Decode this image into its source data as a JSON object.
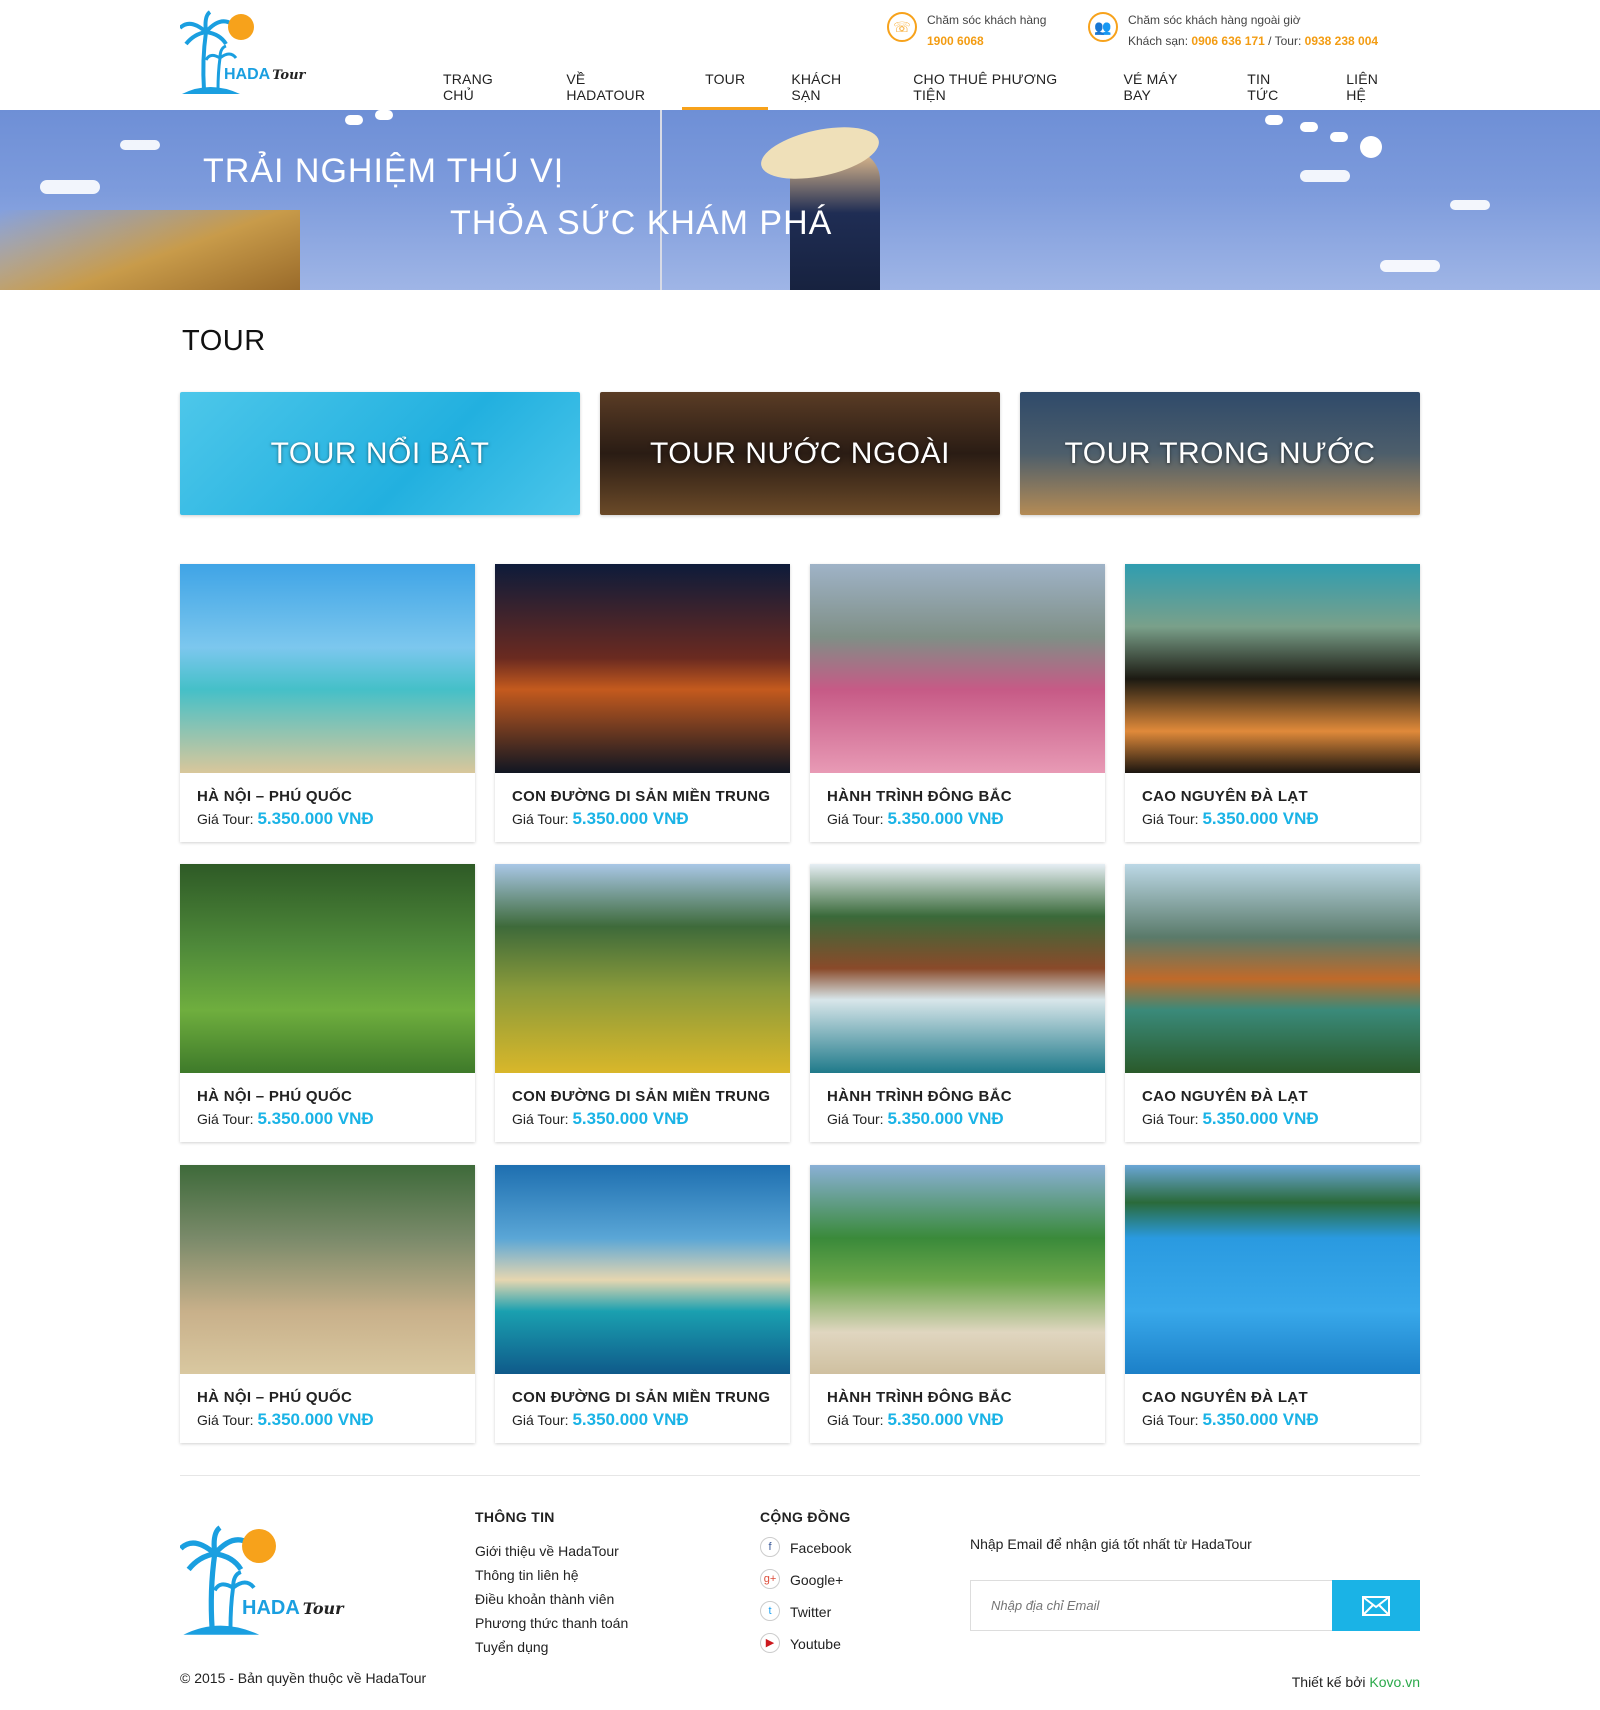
{
  "header": {
    "brand": "HADA",
    "brand_script": "Tour",
    "support": {
      "label": "Chăm sóc khách hàng",
      "phone": "1900 6068"
    },
    "support_after_hours": {
      "label": "Chăm sóc khách hàng ngoài giờ",
      "hotel_label": "Khách sạn:",
      "hotel_phone": "0906 636 171",
      "separator": "/",
      "tour_label": "Tour:",
      "tour_phone": "0938 238 004"
    },
    "nav": [
      {
        "label": "TRANG CHỦ"
      },
      {
        "label": "VỀ HADATOUR"
      },
      {
        "label": "TOUR",
        "active": true
      },
      {
        "label": "KHÁCH SẠN"
      },
      {
        "label": "CHO THUÊ PHƯƠNG TIỆN"
      },
      {
        "label": "VÉ MÁY BAY"
      },
      {
        "label": "TIN TỨC"
      },
      {
        "label": "LIÊN HỆ"
      }
    ]
  },
  "banner": {
    "line1": "TRẢI NGHIỆM THÚ VỊ",
    "line2": "THỎA SỨC KHÁM PHÁ"
  },
  "page_title": "TOUR",
  "categories": [
    {
      "label": "TOUR NỔI BẬT"
    },
    {
      "label": "TOUR NƯỚC NGOÀI"
    },
    {
      "label": "TOUR TRONG NƯỚC"
    }
  ],
  "price_label": "Giá Tour:",
  "tours": [
    {
      "name": "HÀ NỘI – PHÚ QUỐC",
      "price": "5.350.000 VNĐ"
    },
    {
      "name": "CON ĐƯỜNG DI SẢN MIỀN TRUNG",
      "price": "5.350.000 VNĐ"
    },
    {
      "name": "HÀNH TRÌNH ĐÔNG BẮC",
      "price": "5.350.000 VNĐ"
    },
    {
      "name": "CAO NGUYÊN ĐÀ LẠT",
      "price": "5.350.000 VNĐ"
    },
    {
      "name": "HÀ NỘI – PHÚ QUỐC",
      "price": "5.350.000 VNĐ"
    },
    {
      "name": "CON ĐƯỜNG DI SẢN MIỀN TRUNG",
      "price": "5.350.000 VNĐ"
    },
    {
      "name": "HÀNH TRÌNH ĐÔNG BẮC",
      "price": "5.350.000 VNĐ"
    },
    {
      "name": "CAO NGUYÊN ĐÀ LẠT",
      "price": "5.350.000 VNĐ"
    },
    {
      "name": "HÀ NỘI – PHÚ QUỐC",
      "price": "5.350.000 VNĐ"
    },
    {
      "name": "CON ĐƯỜNG DI SẢN MIỀN TRUNG",
      "price": "5.350.000 VNĐ"
    },
    {
      "name": "HÀNH TRÌNH ĐÔNG BẮC",
      "price": "5.350.000 VNĐ"
    },
    {
      "name": "CAO NGUYÊN ĐÀ LẠT",
      "price": "5.350.000 VNĐ"
    }
  ],
  "footer": {
    "info_title": "THÔNG TIN",
    "info_links": [
      "Giới thiệu về HadaTour",
      "Thông tin liên hệ",
      "Điều khoản thành viên",
      "Phương thức thanh toán",
      "Tuyển dụng"
    ],
    "community_title": "CỘNG ĐỒNG",
    "social": [
      {
        "label": "Facebook",
        "icon": "facebook-icon",
        "glyph": "f",
        "color": "#3b5998"
      },
      {
        "label": "Google+",
        "icon": "google-plus-icon",
        "glyph": "g+",
        "color": "#dd4b39"
      },
      {
        "label": "Twitter",
        "icon": "twitter-icon",
        "glyph": "t",
        "color": "#1da1f2"
      },
      {
        "label": "Youtube",
        "icon": "youtube-icon",
        "glyph": "▶",
        "color": "#cc181e"
      }
    ],
    "subscribe_text": "Nhập Email để nhận giá tốt nhất từ HadaTour",
    "email_placeholder": "Nhập địa chỉ Email",
    "copyright": "© 2015 - Bản quyền thuộc về HadaTour",
    "designed_by_label": "Thiết kế bởi",
    "designed_by_name": "Kovo.vn"
  },
  "colors": {
    "accent": "#f7a21b",
    "price": "#1ab3e6",
    "brand": "#1a9fe0"
  }
}
